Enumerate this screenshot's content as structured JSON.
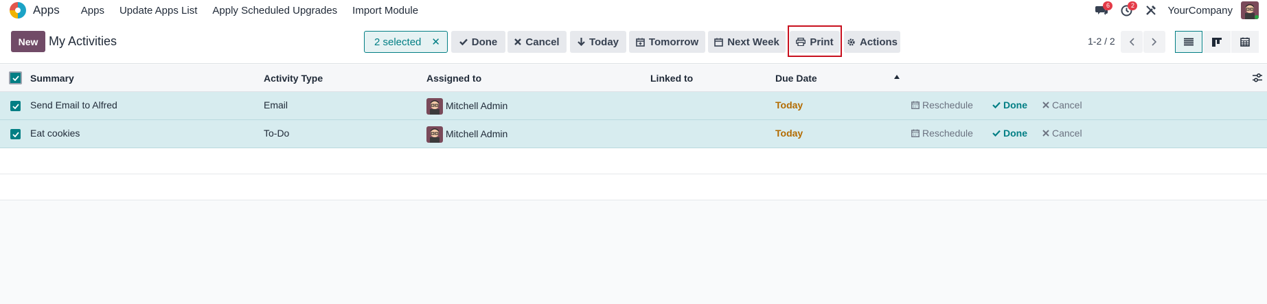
{
  "topbar": {
    "app_name": "Apps",
    "menu": [
      "Apps",
      "Update Apps List",
      "Apply Scheduled Upgrades",
      "Import Module"
    ],
    "messages_count": "6",
    "activities_count": "2",
    "company": "YourCompany"
  },
  "control": {
    "new_label": "New",
    "title": "My Activities",
    "selected_label": "2 selected",
    "buttons": {
      "done": "Done",
      "cancel": "Cancel",
      "today": "Today",
      "tomorrow": "Tomorrow",
      "next_week": "Next Week",
      "print": "Print",
      "actions": "Actions"
    },
    "pager": "1-2 / 2"
  },
  "table": {
    "headers": {
      "summary": "Summary",
      "activity_type": "Activity Type",
      "assigned_to": "Assigned to",
      "linked_to": "Linked to",
      "due_date": "Due Date"
    },
    "rows": [
      {
        "summary": "Send Email to Alfred",
        "type": "Email",
        "assigned": "Mitchell Admin",
        "due": "Today",
        "reschedule": "Reschedule",
        "done": "Done",
        "cancel": "Cancel"
      },
      {
        "summary": "Eat cookies",
        "type": "To-Do",
        "assigned": "Mitchell Admin",
        "due": "Today",
        "reschedule": "Reschedule",
        "done": "Done",
        "cancel": "Cancel"
      }
    ]
  },
  "colors": {
    "brand": "#714b67",
    "accent": "#017e84",
    "highlight": "#c8101e",
    "due": "#b36b00"
  }
}
